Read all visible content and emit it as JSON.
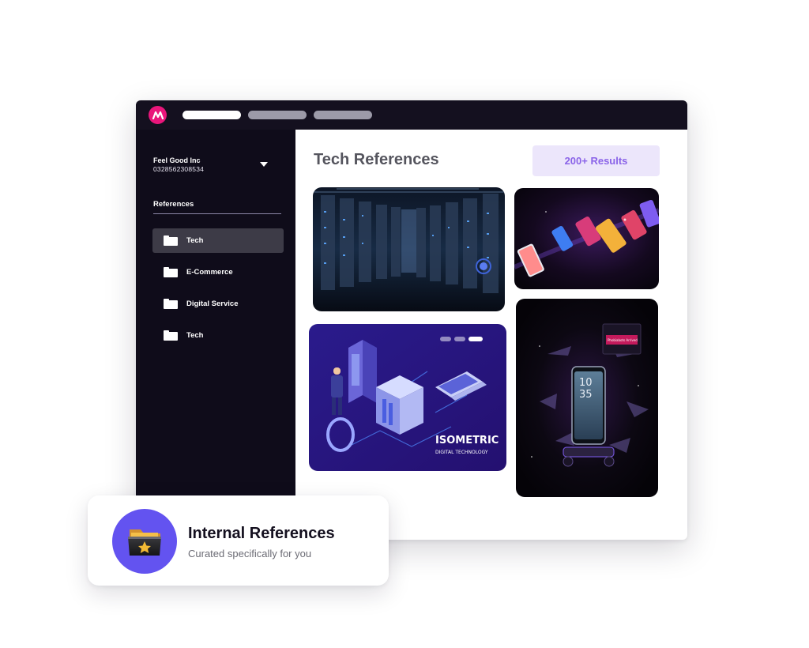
{
  "titlebar": {
    "tabs": [
      {
        "state": "active",
        "color": "#ffffff"
      },
      {
        "state": "inactive",
        "color": "#9c9aa8"
      },
      {
        "state": "inactive",
        "color": "#9c9aa8"
      }
    ],
    "logo_color": "#e9167b"
  },
  "sidebar": {
    "org_name": "Feel Good Inc",
    "org_phone": "0328562308534",
    "section_label": "References",
    "items": [
      {
        "label": "Tech",
        "active": true
      },
      {
        "label": "E-Commerce",
        "active": false
      },
      {
        "label": "Digital Service",
        "active": false
      },
      {
        "label": "Tech",
        "active": false
      }
    ]
  },
  "main": {
    "title": "Tech References",
    "results_badge": "200+ Results",
    "cards": [
      {
        "icon": "server-room-image"
      },
      {
        "icon": "floating-phones-image"
      },
      {
        "icon": "isometric-illustration-image",
        "text_line1": "ISOMETRIC",
        "text_line2": "DIGITAL TECHNOLOGY"
      },
      {
        "icon": "smartphone-drones-image",
        "clock_hour": "10",
        "clock_min": "35",
        "notification": "Phobiabots Arrived"
      }
    ]
  },
  "float_card": {
    "title": "Internal References",
    "subtitle": "Curated specifically for you",
    "icon": "star-folder-icon"
  },
  "colors": {
    "titlebar_bg": "#14101f",
    "sidebar_bg": "#0f0c1a",
    "accent_purple": "#8a63e8",
    "badge_bg": "#ece6fb",
    "float_icon_bg": "#6353f0"
  }
}
